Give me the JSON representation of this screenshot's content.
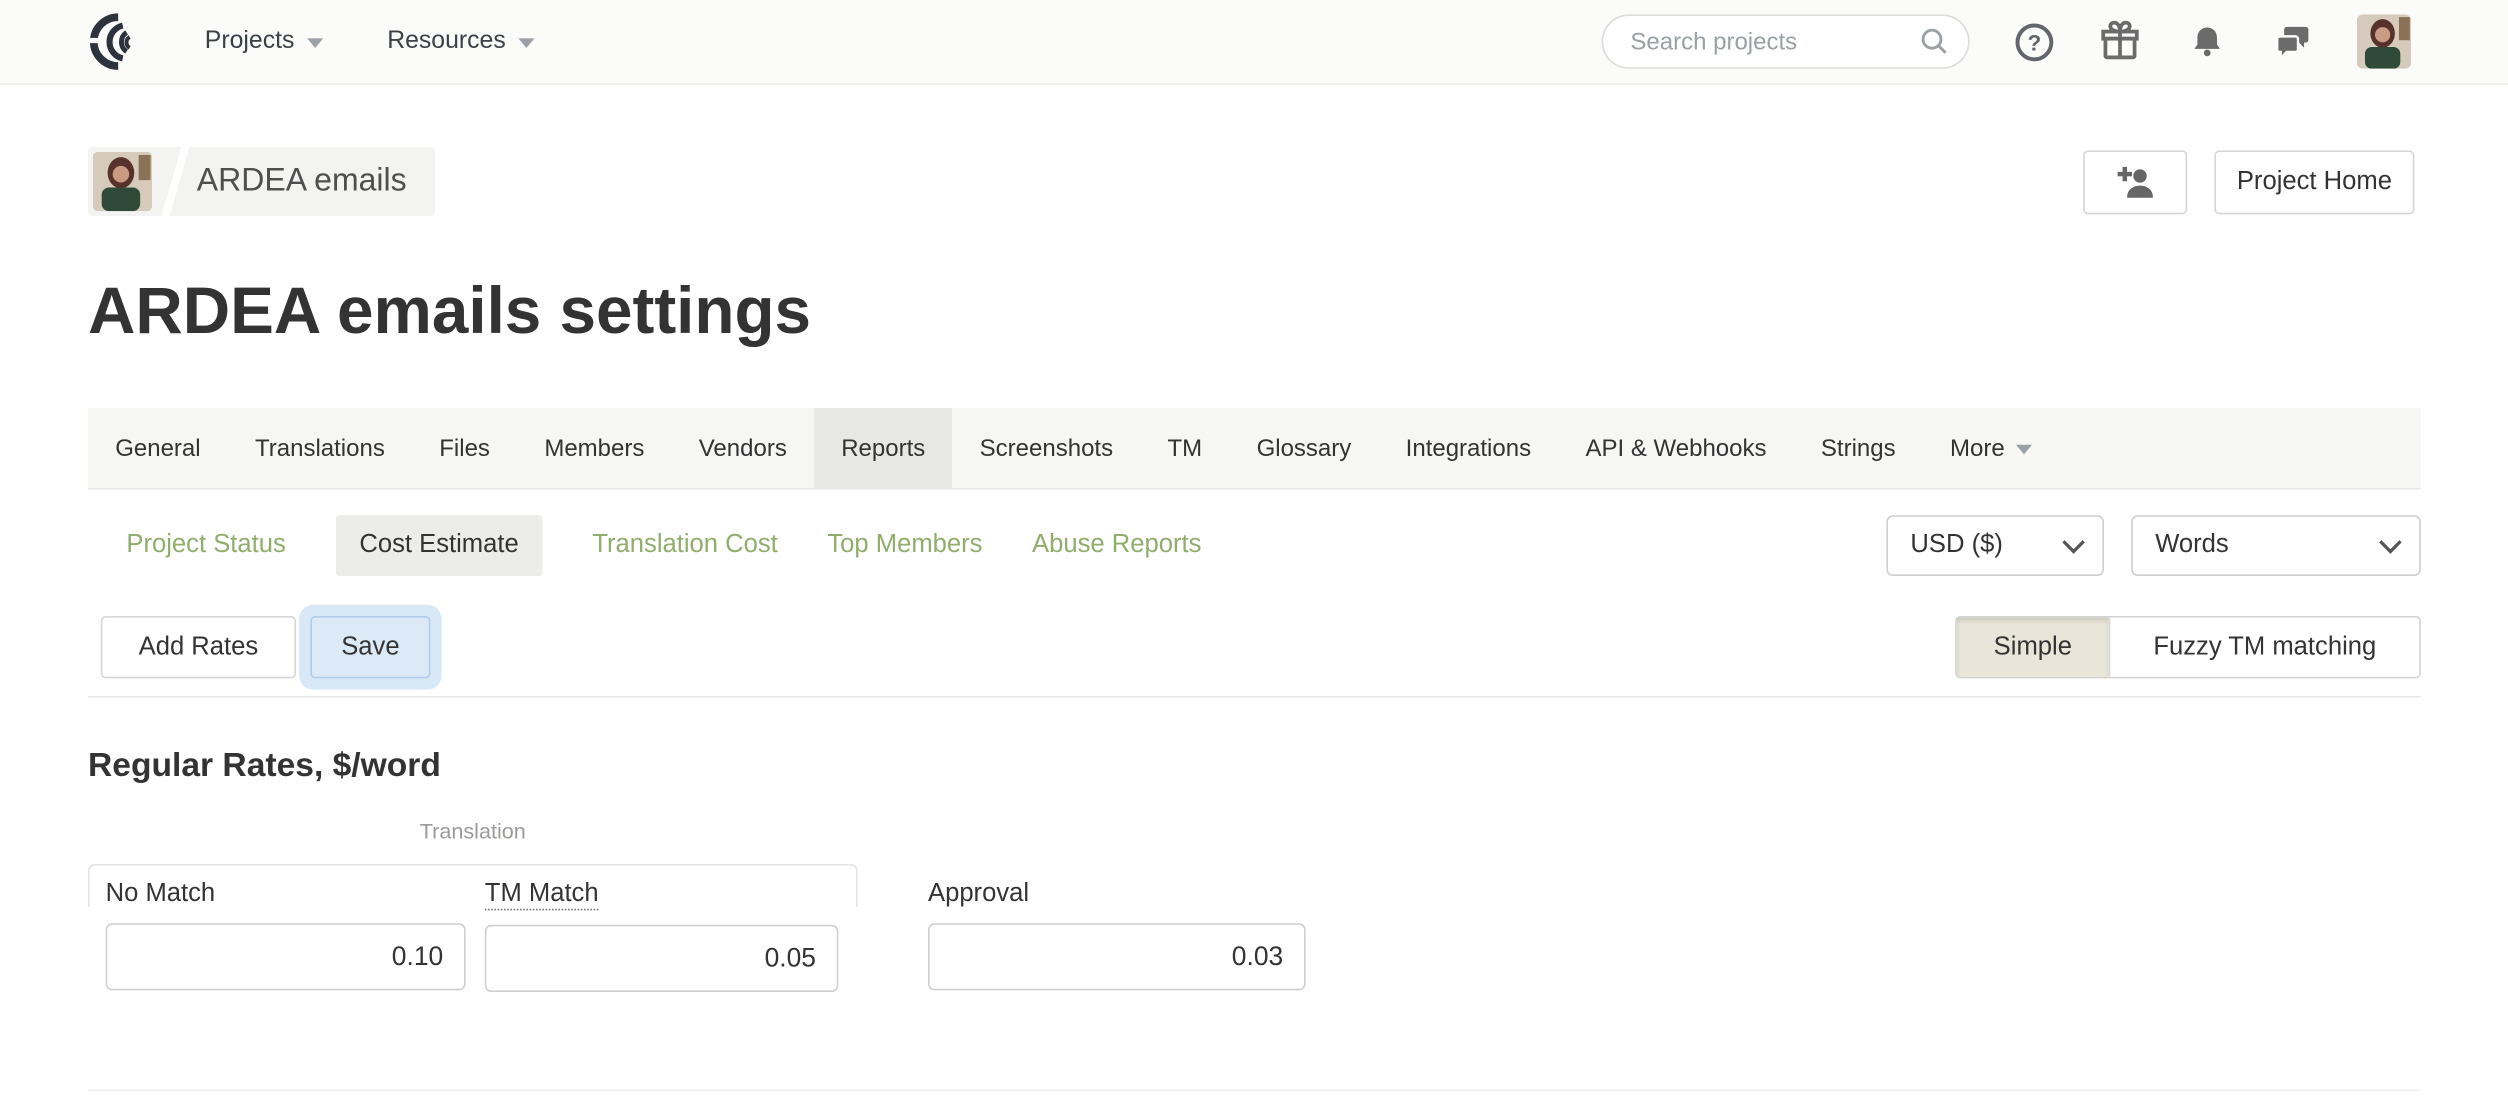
{
  "nav": {
    "projects_label": "Projects",
    "resources_label": "Resources",
    "search_placeholder": "Search projects",
    "help_glyph": "?"
  },
  "breadcrumb": {
    "project_name": "ARDEA emails"
  },
  "header": {
    "title": "ARDEA emails settings",
    "project_home_label": "Project Home"
  },
  "tabs": {
    "items": [
      "General",
      "Translations",
      "Files",
      "Members",
      "Vendors",
      "Reports",
      "Screenshots",
      "TM",
      "Glossary",
      "Integrations",
      "API & Webhooks",
      "Strings"
    ],
    "more_label": "More",
    "active": "Reports"
  },
  "subtabs": {
    "items": [
      "Project Status",
      "Cost Estimate",
      "Translation Cost",
      "Top Members",
      "Abuse Reports"
    ],
    "active": "Cost Estimate",
    "currency_value": "USD ($)",
    "unit_value": "Words"
  },
  "actions": {
    "add_rates_label": "Add Rates",
    "save_label": "Save",
    "mode_simple_label": "Simple",
    "mode_fuzzy_label": "Fuzzy TM matching",
    "active_mode": "Simple"
  },
  "rates": {
    "heading": "Regular Rates, $/word",
    "group_label": "Translation",
    "fields": [
      {
        "label": "No Match",
        "value": "0.10"
      },
      {
        "label": "TM Match",
        "value": "0.05"
      },
      {
        "label": "Approval",
        "value": "0.03"
      }
    ]
  },
  "colors": {
    "accent_green": "#8fae6c",
    "save_focus_blue": "#d8e8f7",
    "save_button_bg": "#dceaf8",
    "active_segment_beige": "#e9e5d9",
    "active_tab_gray": "#e7e7e5",
    "nav_bg": "#fbfbfa"
  }
}
